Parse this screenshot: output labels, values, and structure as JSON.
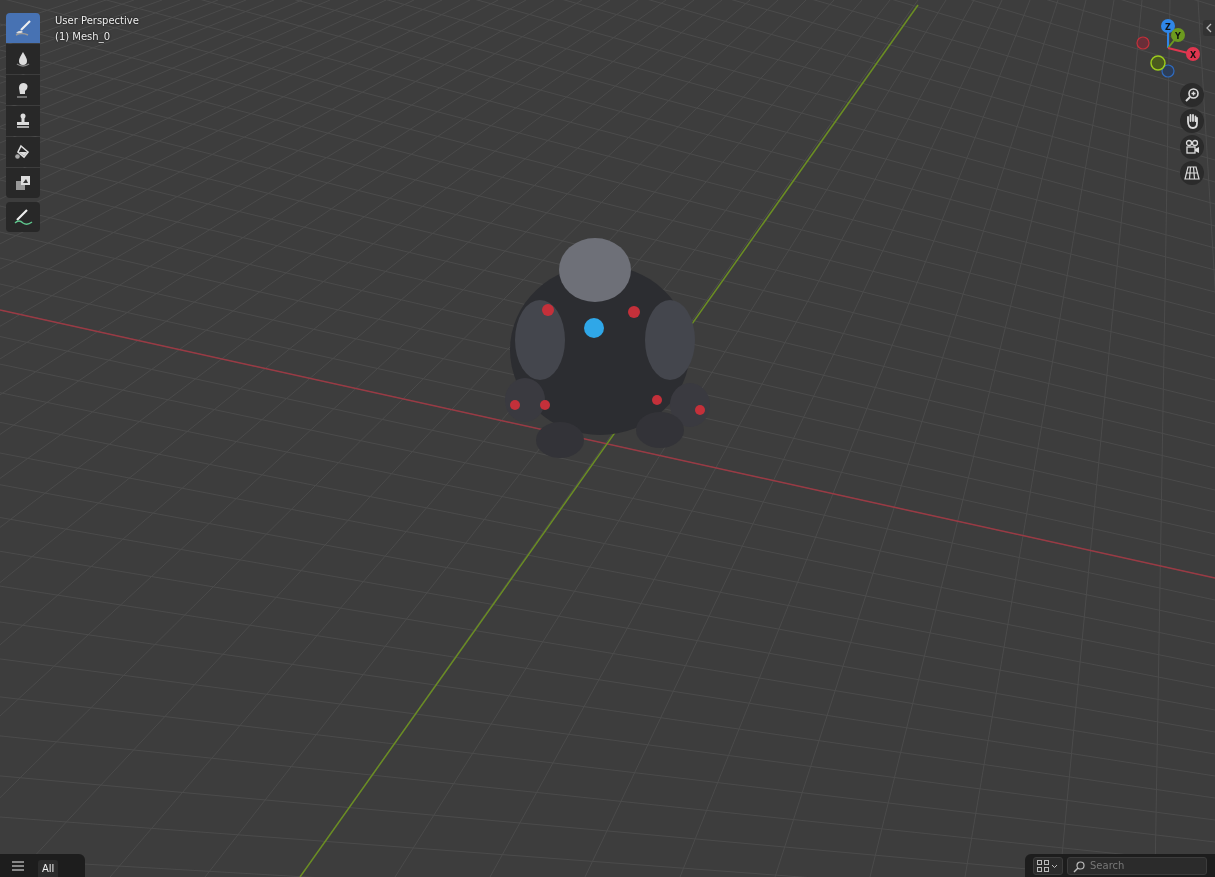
{
  "viewport": {
    "view_name": "User Perspective",
    "object_name": "(1) Mesh_0"
  },
  "tools": [
    {
      "kind": "brush",
      "selected": true
    },
    {
      "kind": "blur",
      "selected": false
    },
    {
      "kind": "smear",
      "selected": false
    },
    {
      "kind": "clone",
      "selected": false
    },
    {
      "kind": "fill",
      "selected": false
    },
    {
      "kind": "mask",
      "selected": false
    },
    {
      "kind": "annotate",
      "selected": false
    }
  ],
  "gizmo": {
    "axes": [
      {
        "label": "Z",
        "color": "#2f86e8"
      },
      {
        "label": "Y",
        "color": "#6c9a1f"
      },
      {
        "label": "X",
        "color": "#e0364f"
      }
    ]
  },
  "asset_bar": {
    "filter_tab": "All",
    "search": {
      "placeholder": "Search"
    }
  }
}
